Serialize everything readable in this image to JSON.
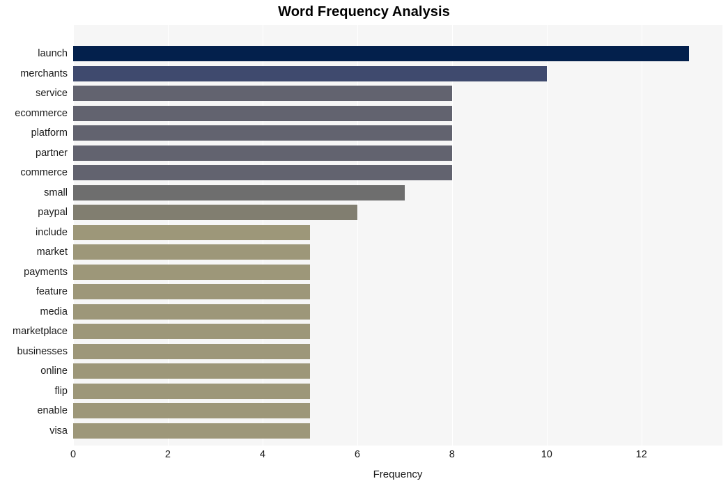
{
  "chart_data": {
    "type": "bar",
    "orientation": "horizontal",
    "title": "Word Frequency Analysis",
    "xlabel": "Frequency",
    "ylabel": "",
    "categories": [
      "launch",
      "merchants",
      "service",
      "ecommerce",
      "platform",
      "partner",
      "commerce",
      "small",
      "paypal",
      "include",
      "market",
      "payments",
      "feature",
      "media",
      "marketplace",
      "businesses",
      "online",
      "flip",
      "enable",
      "visa"
    ],
    "values": [
      13,
      10,
      8,
      8,
      8,
      8,
      8,
      7,
      6,
      5,
      5,
      5,
      5,
      5,
      5,
      5,
      5,
      5,
      5,
      5
    ],
    "bar_colors": [
      "#03204c",
      "#3f4a६e",
      "#62636f",
      "#62636f",
      "#62636f",
      "#62636f",
      "#62636f",
      "#6e6e6e",
      "#817e70",
      "#9d9779",
      "#9d9779",
      "#9d9779",
      "#9d9779",
      "#9d9779",
      "#9d9779",
      "#9d9779",
      "#9d9779",
      "#9d9779",
      "#9d9779",
      "#9d9779"
    ],
    "xlim": [
      0,
      13.71
    ],
    "xticks": [
      0,
      2,
      4,
      6,
      8,
      10,
      12
    ],
    "xtick_labels": [
      "0",
      "2",
      "4",
      "6",
      "8",
      "10",
      "12"
    ],
    "grid": true,
    "grid_axis": "x",
    "grid_color": "#ffffff",
    "plot_background": "#f6f6f6",
    "figure_background": "#ffffff",
    "legend": null,
    "title_color": "#000000",
    "tick_label_color": "#1a1a1a"
  }
}
